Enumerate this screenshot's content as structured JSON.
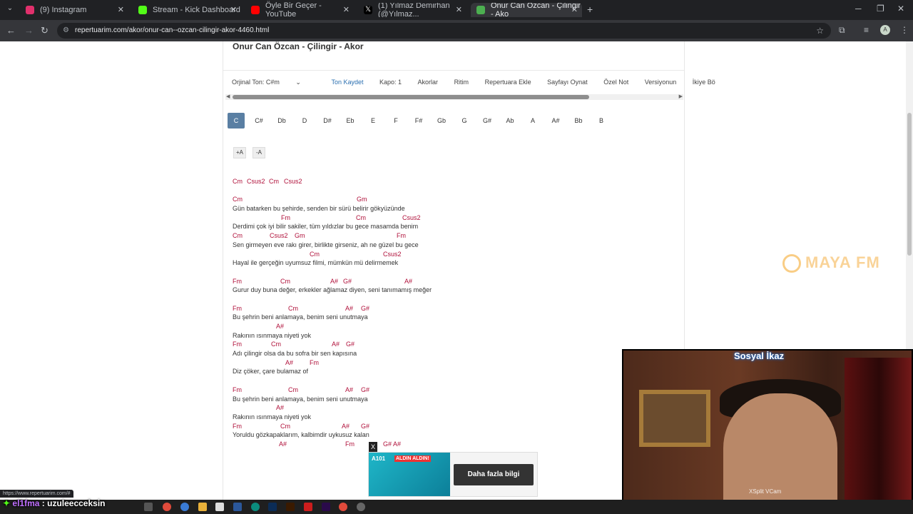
{
  "tabs": [
    {
      "label": "(9) Instagram",
      "icon": "instagram-icon",
      "color": "#e1306c"
    },
    {
      "label": "Stream - Kick Dashboard",
      "icon": "kick-icon",
      "color": "#53fc18"
    },
    {
      "label": "Öyle Bir Geçer - YouTube",
      "icon": "youtube-icon",
      "color": "#ff0000"
    },
    {
      "label": "(1) Yılmaz Demirhan (@Yılmaz...",
      "icon": "x-icon",
      "color": "#ffffff"
    },
    {
      "label": "Onur Can Özcan - Çilingir - Ako",
      "icon": "repertuarim-icon",
      "color": "#4caf50"
    }
  ],
  "address": {
    "url": "repertuarim.com/akor/onur-can--ozcan-cilingir-akor-4460.html"
  },
  "page": {
    "title": "Onur Can Özcan - Çilingir - Akor",
    "menu": {
      "original_key": "Orjinal Ton: C#m",
      "save_key": "Ton Kaydet",
      "capo": "Kapo: 1",
      "chords": "Akorlar",
      "rhythm": "Ritim",
      "add_repertoire": "Repertuara Ekle",
      "play_page": "Sayfayı Oynat",
      "special_note": "Özel Not",
      "versions": "Versiyonun",
      "two_col": "İkiye Bö"
    },
    "keys": [
      "C",
      "C#",
      "Db",
      "D",
      "D#",
      "Eb",
      "E",
      "F",
      "F#",
      "Gb",
      "G",
      "G#",
      "Ab",
      "A",
      "A#",
      "Bb",
      "B"
    ],
    "active_key": "C",
    "font_plus": "+A",
    "font_minus": "-A"
  },
  "lyrics": [
    {
      "type": "chord",
      "chords": [
        [
          "Cm",
          0
        ],
        [
          "Csus2",
          20
        ],
        [
          "Cm",
          51
        ],
        [
          "Csus2",
          72
        ]
      ]
    },
    {
      "type": "blank"
    },
    {
      "type": "chord",
      "chords": [
        [
          "Cm",
          0
        ],
        [
          "Gm",
          174
        ]
      ]
    },
    {
      "type": "text",
      "text": "Gün batarken bu şehirde, senden bir sürü belirir gökyüzünde"
    },
    {
      "type": "chord",
      "chords": [
        [
          "Fm",
          68
        ],
        [
          "Cm",
          173
        ],
        [
          "Csus2",
          238
        ]
      ]
    },
    {
      "type": "text",
      "text": "Derdimi çok iyi bilir sakiler, tüm yıldızlar bu gece masamda benim"
    },
    {
      "type": "chord",
      "chords": [
        [
          "Cm",
          0
        ],
        [
          "Csus2",
          52
        ],
        [
          "Gm",
          87
        ],
        [
          "Fm",
          230
        ]
      ]
    },
    {
      "type": "text",
      "text": "Sen girmeyen eve rakı girer, birlikte girseniz, ah ne güzel bu gece"
    },
    {
      "type": "chord",
      "chords": [
        [
          "Cm",
          108
        ],
        [
          "Csus2",
          211
        ]
      ]
    },
    {
      "type": "text",
      "text": "Hayal ile gerçeğin uyumsuz filmi, mümkün mü delirmemek"
    },
    {
      "type": "blank"
    },
    {
      "type": "chord",
      "chords": [
        [
          "Fm",
          0
        ],
        [
          "Cm",
          67
        ],
        [
          "A#",
          137
        ],
        [
          "G#",
          155
        ],
        [
          "A#",
          241
        ]
      ]
    },
    {
      "type": "text",
      "text": "Gurur duy buna değer, erkekler ağlamaz diyen, seni tanımamış meğer"
    },
    {
      "type": "blank"
    },
    {
      "type": "chord",
      "chords": [
        [
          "Fm",
          0
        ],
        [
          "Cm",
          78
        ],
        [
          "A#",
          158
        ],
        [
          "G#",
          180
        ]
      ]
    },
    {
      "type": "text",
      "text": "Bu şehrin beni anlamaya, benim seni unutmaya"
    },
    {
      "type": "chord",
      "chords": [
        [
          "A#",
          61
        ]
      ]
    },
    {
      "type": "text",
      "text": "Rakının ısınmaya niyeti yok"
    },
    {
      "type": "chord",
      "chords": [
        [
          "Fm",
          0
        ],
        [
          "Cm",
          54
        ],
        [
          "A#",
          139
        ],
        [
          "G#",
          159
        ]
      ]
    },
    {
      "type": "text",
      "text": "Adı çilingir olsa da bu sofra bir sen kapısına"
    },
    {
      "type": "chord",
      "chords": [
        [
          "A#",
          74
        ],
        [
          "Fm",
          108
        ]
      ]
    },
    {
      "type": "text",
      "text": "Diz çöker, çare bulamaz of"
    },
    {
      "type": "blank"
    },
    {
      "type": "chord",
      "chords": [
        [
          "Fm",
          0
        ],
        [
          "Cm",
          78
        ],
        [
          "A#",
          158
        ],
        [
          "G#",
          180
        ]
      ]
    },
    {
      "type": "text",
      "text": "Bu şehrin beni anlamaya, benim seni unutmaya"
    },
    {
      "type": "chord",
      "chords": [
        [
          "A#",
          61
        ]
      ]
    },
    {
      "type": "text",
      "text": "Rakının ısınmaya niyeti yok"
    },
    {
      "type": "chord",
      "chords": [
        [
          "Fm",
          0
        ],
        [
          "Cm",
          67
        ],
        [
          "A#",
          153
        ],
        [
          "G#",
          180
        ]
      ]
    },
    {
      "type": "text",
      "text": "Yoruldu gözkapaklarım, kalbimdir uykusuz kalan"
    },
    {
      "type": "chord",
      "chords": [
        [
          "A#",
          65
        ],
        [
          "Fm",
          158
        ],
        [
          "G# A#",
          211
        ]
      ]
    }
  ],
  "watermark": {
    "text": "MAYA FM",
    "color": "#f5a623"
  },
  "webcam": {
    "title": "Sosyal İkaz",
    "source": "XSplit VCam"
  },
  "ad": {
    "badge": "A101",
    "promo": "ALDIN ALDIN!",
    "cta": "Daha fazla bilgi",
    "close": "X"
  },
  "status_url": "https://www.repertuarim.com/#",
  "chat": {
    "user": "el1fma",
    "sep": " : ",
    "message": "uzuleecceksin"
  }
}
